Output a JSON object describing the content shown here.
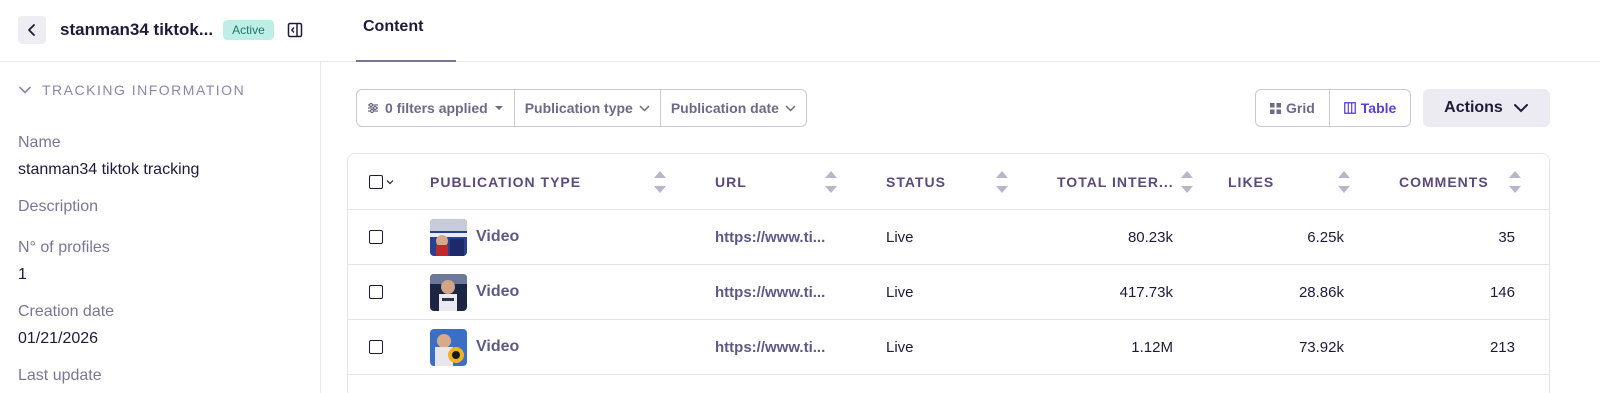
{
  "header": {
    "title": "stanman34 tiktok...",
    "status_badge": "Active"
  },
  "tabs": [
    {
      "label": "Content"
    }
  ],
  "sidebar": {
    "section_title": "TRACKING INFORMATION",
    "fields": [
      {
        "label": "Name",
        "value": "stanman34 tiktok tracking"
      },
      {
        "label": "Description",
        "value": ""
      },
      {
        "label": "N° of profiles",
        "value": "1"
      },
      {
        "label": "Creation date",
        "value": "01/21/2026"
      },
      {
        "label": "Last update",
        "value": ""
      }
    ]
  },
  "filters": {
    "applied": "0 filters applied",
    "publication_type": "Publication type",
    "publication_date": "Publication date"
  },
  "view_toggle": {
    "grid": "Grid",
    "table": "Table",
    "active": "table"
  },
  "actions_label": "Actions",
  "table": {
    "columns": [
      "PUBLICATION TYPE",
      "URL",
      "STATUS",
      "TOTAL INTER...",
      "LIKES",
      "COMMENTS"
    ],
    "rows": [
      {
        "type": "Video",
        "url": "https://www.ti...",
        "status": "Live",
        "total_interactions": "80.23k",
        "likes": "6.25k",
        "comments": "35"
      },
      {
        "type": "Video",
        "url": "https://www.ti...",
        "status": "Live",
        "total_interactions": "417.73k",
        "likes": "28.86k",
        "comments": "146"
      },
      {
        "type": "Video",
        "url": "https://www.ti...",
        "status": "Live",
        "total_interactions": "1.12M",
        "likes": "73.92k",
        "comments": "213"
      }
    ]
  },
  "colors": {
    "accent": "#5b3fd9",
    "badge_bg": "#bfeee6",
    "badge_text": "#1a7a6a",
    "link": "#5c5a86"
  },
  "icons": {
    "back": "chevron-left-icon",
    "collapse": "sidebar-collapse-icon",
    "section_toggle": "chevron-down-icon",
    "filters": "sliders-icon",
    "grid": "grid-icon",
    "table": "columns-icon"
  }
}
